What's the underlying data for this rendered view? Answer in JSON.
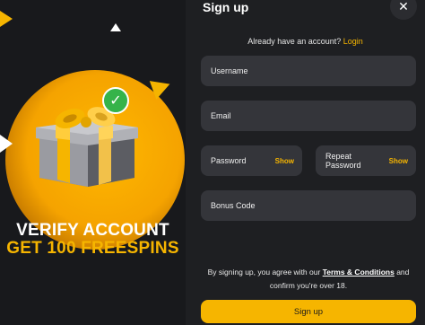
{
  "promo": {
    "line1": "VERIFY ACCOUNT",
    "line2": "GET 100 FREESPINS",
    "check_icon": "✓",
    "colors": {
      "accent": "#f6b500",
      "check": "#35b34a"
    }
  },
  "form": {
    "title": "Sign up",
    "close_icon": "✕",
    "have_account": "Already have an account?",
    "login_link": "Login",
    "fields": {
      "username_placeholder": "Username",
      "email_placeholder": "Email",
      "password_placeholder": "Password",
      "password_toggle": "Show",
      "repeat_password_placeholder": "Repeat Password",
      "repeat_password_toggle": "Show",
      "bonus_code_placeholder": "Bonus Code"
    },
    "terms_prefix": "By signing up, you agree with our",
    "terms_link": "Terms & Conditions",
    "terms_suffix": "and confirm you're over 18.",
    "submit_label": "Sign up"
  }
}
